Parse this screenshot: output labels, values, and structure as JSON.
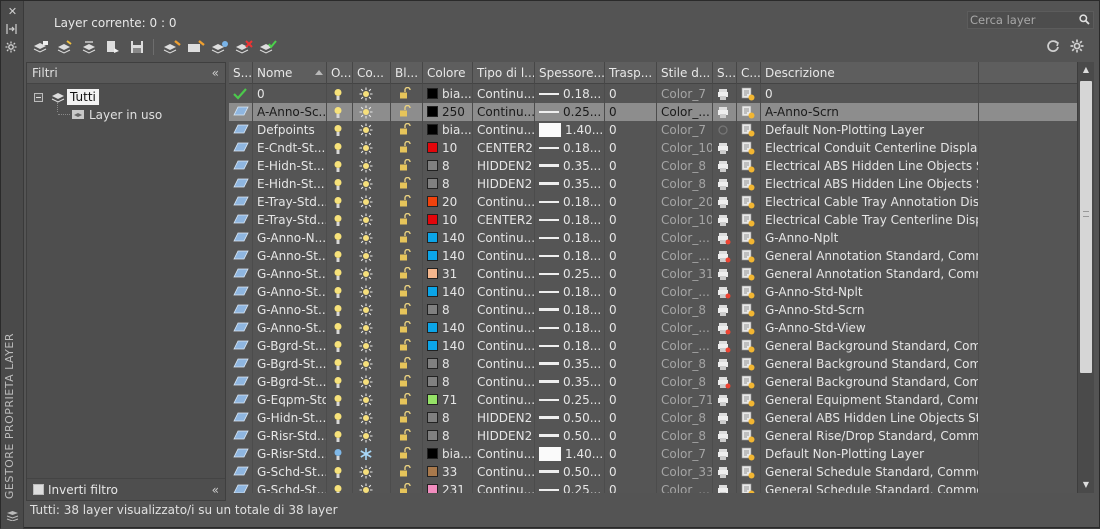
{
  "current_layer": "Layer corrente: 0 : 0",
  "search": {
    "placeholder": "Cerca layer"
  },
  "vertical_title": "GESTORE PROPRIETA LAYER",
  "filters": {
    "title": "Filtri",
    "root": "Tutti",
    "child": "Layer in uso",
    "invert": "Inverti filtro"
  },
  "columns": [
    "S...",
    "Nome",
    "O...",
    "Co...",
    "Bl...",
    "Colore",
    "Tipo di l...",
    "Spessore...",
    "Trasp...",
    "Stile d...",
    "S...",
    "C...",
    "Descrizione"
  ],
  "colors": {
    "red": "#e3060b",
    "cyan": "#0ba5e8",
    "gray": "#808080",
    "orange": "#f06b1a",
    "peach": "#f5b78e",
    "lime": "#95e267",
    "brown": "#a8794c",
    "pink": "#f28dbf",
    "black": "#000000",
    "white": "#ffffff"
  },
  "rows": [
    {
      "name": "0",
      "color": "bia...",
      "swatch": "#000000",
      "ltype": "Continu...",
      "lw": "0.18...",
      "lwstyle": "thin",
      "tr": "0",
      "plot": "Color_7",
      "desc": "0",
      "current": true
    },
    {
      "name": "A-Anno-Sc...",
      "color": "250",
      "swatch": "#000000",
      "ltype": "Continu...",
      "lw": "0.25...",
      "lwstyle": "thin",
      "tr": "0",
      "plot": "Color_...",
      "desc": "A-Anno-Scrn",
      "selected": true
    },
    {
      "name": "Defpoints",
      "color": "bia...",
      "swatch": "#000000",
      "ltype": "Continu...",
      "lw": "1.40...",
      "lwstyle": "box",
      "tr": "0",
      "plot": "Color_7",
      "desc": "Default Non-Plotting Layer",
      "noplot": true
    },
    {
      "name": "E-Cndt-St...",
      "color": "10",
      "swatch": "#e3060b",
      "ltype": "CENTER2",
      "lw": "0.18...",
      "lwstyle": "thin",
      "tr": "0",
      "plot": "Color_10",
      "desc": "Electrical Conduit Centerline Display..."
    },
    {
      "name": "E-Hidn-St...",
      "color": "8",
      "swatch": "#808080",
      "ltype": "HIDDEN2",
      "lw": "0.35...",
      "lwstyle": "thick",
      "tr": "0",
      "plot": "Color_8",
      "desc": "Electrical ABS Hidden Line Objects St..."
    },
    {
      "name": "E-Hidn-St...",
      "color": "8",
      "swatch": "#808080",
      "ltype": "HIDDEN2",
      "lw": "0.35...",
      "lwstyle": "thick",
      "tr": "0",
      "plot": "Color_8",
      "desc": "Electrical ABS Hidden Line Objects St..."
    },
    {
      "name": "E-Tray-Std...",
      "color": "20",
      "swatch": "#f0420c",
      "ltype": "Continu...",
      "lw": "0.18...",
      "lwstyle": "thin",
      "tr": "0",
      "plot": "Color_20",
      "desc": "Electrical Cable Tray Annotation Disp..."
    },
    {
      "name": "E-Tray-Std...",
      "color": "10",
      "swatch": "#e3060b",
      "ltype": "CENTER2",
      "lw": "0.18...",
      "lwstyle": "thin",
      "tr": "0",
      "plot": "Color_10",
      "desc": "Electrical Cable Tray Centerline Displ..."
    },
    {
      "name": "G-Anno-N...",
      "color": "140",
      "swatch": "#0ba5e8",
      "ltype": "Continu...",
      "lw": "0.18...",
      "lwstyle": "thin",
      "tr": "0",
      "plot": "Color_...",
      "desc": "G-Anno-Nplt",
      "noplotred": true
    },
    {
      "name": "G-Anno-St...",
      "color": "140",
      "swatch": "#0ba5e8",
      "ltype": "Continu...",
      "lw": "0.18...",
      "lwstyle": "thin",
      "tr": "0",
      "plot": "Color_...",
      "desc": "General Annotation Standard, Comm...",
      "noplotred": true
    },
    {
      "name": "G-Anno-St...",
      "color": "31",
      "swatch": "#f5b78e",
      "ltype": "Continu...",
      "lw": "0.25...",
      "lwstyle": "thin",
      "tr": "0",
      "plot": "Color_31",
      "desc": "General Annotation Standard, Comm..."
    },
    {
      "name": "G-Anno-St...",
      "color": "140",
      "swatch": "#0ba5e8",
      "ltype": "Continu...",
      "lw": "0.18...",
      "lwstyle": "thin",
      "tr": "0",
      "plot": "Color_...",
      "desc": "G-Anno-Std-Nplt",
      "noplotred": true
    },
    {
      "name": "G-Anno-St...",
      "color": "8",
      "swatch": "#808080",
      "ltype": "Continu...",
      "lw": "0.18...",
      "lwstyle": "thick",
      "tr": "0",
      "plot": "Color_8",
      "desc": "G-Anno-Std-Scrn"
    },
    {
      "name": "G-Anno-St...",
      "color": "140",
      "swatch": "#0ba5e8",
      "ltype": "Continu...",
      "lw": "0.18...",
      "lwstyle": "thin",
      "tr": "0",
      "plot": "Color_...",
      "desc": "G-Anno-Std-View",
      "noplotred": true
    },
    {
      "name": "G-Bgrd-St...",
      "color": "140",
      "swatch": "#0ba5e8",
      "ltype": "Continu...",
      "lw": "0.18...",
      "lwstyle": "thin",
      "tr": "0",
      "plot": "Color_...",
      "desc": "General Background Standard, Com...",
      "noplotred": true
    },
    {
      "name": "G-Bgrd-St...",
      "color": "8",
      "swatch": "#808080",
      "ltype": "Continu...",
      "lw": "0.35...",
      "lwstyle": "thick",
      "tr": "0",
      "plot": "Color_8",
      "desc": "General Background Standard, Com..."
    },
    {
      "name": "G-Bgrd-St...",
      "color": "8",
      "swatch": "#808080",
      "ltype": "Continu...",
      "lw": "0.35...",
      "lwstyle": "thick",
      "tr": "0",
      "plot": "Color_8",
      "desc": "General Background Standard, Com...",
      "noplotred": true
    },
    {
      "name": "G-Eqpm-Std",
      "color": "71",
      "swatch": "#95e267",
      "ltype": "Continu...",
      "lw": "0.25...",
      "lwstyle": "thin",
      "tr": "0",
      "plot": "Color_71",
      "desc": "General Equipment Standard, Comm..."
    },
    {
      "name": "G-Hidn-St...",
      "color": "8",
      "swatch": "#808080",
      "ltype": "HIDDEN2",
      "lw": "0.50...",
      "lwstyle": "thick",
      "tr": "0",
      "plot": "Color_8",
      "desc": "General ABS Hidden Line Objects Sta..."
    },
    {
      "name": "G-Risr-Std...",
      "color": "8",
      "swatch": "#808080",
      "ltype": "HIDDEN2",
      "lw": "0.50...",
      "lwstyle": "thick",
      "tr": "0",
      "plot": "Color_8",
      "desc": "General Rise/Drop Standard, Commo..."
    },
    {
      "name": "G-Risr-Std...",
      "color": "bia...",
      "swatch": "#000000",
      "ltype": "Continu...",
      "lw": "1.40...",
      "lwstyle": "box",
      "tr": "0",
      "plot": "Color_7",
      "desc": "Default Non-Plotting Layer",
      "frozen": true
    },
    {
      "name": "G-Schd-St...",
      "color": "33",
      "swatch": "#a8794c",
      "ltype": "Continu...",
      "lw": "0.50...",
      "lwstyle": "thick",
      "tr": "0",
      "plot": "Color_33",
      "desc": "General Schedule Standard, Comme..."
    },
    {
      "name": "G-Schd-St...",
      "color": "231",
      "swatch": "#f28dbf",
      "ltype": "Continu...",
      "lw": "0.25...",
      "lwstyle": "thin",
      "tr": "0",
      "plot": "Color_...",
      "desc": "General Schedule Standard, Comme..."
    }
  ],
  "status": "Tutti: 38 layer visualizzato/i su un totale di 38 layer"
}
